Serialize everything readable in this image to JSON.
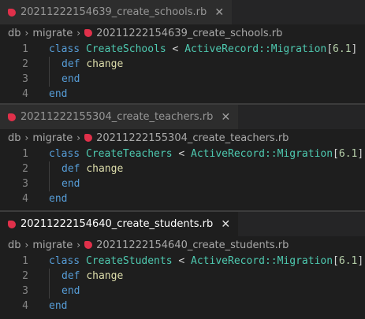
{
  "panes": [
    {
      "tab": {
        "filename": "20211222154639_create_schools.rb",
        "active": false,
        "close": "✕"
      },
      "breadcrumb": {
        "dir1": "db",
        "dir2": "migrate",
        "file": "20211222154639_create_schools.rb"
      },
      "code": {
        "line_numbers": [
          "1",
          "2",
          "3",
          "4"
        ],
        "class_kw": "class",
        "class_name": "CreateSchools",
        "lt": "<",
        "parent": "ActiveRecord::Migration",
        "bracket_open": "[",
        "version": "6.1",
        "bracket_close": "]",
        "def_kw": "def",
        "method": "change",
        "end_inner": "end",
        "end_outer": "end"
      }
    },
    {
      "tab": {
        "filename": "20211222155304_create_teachers.rb",
        "active": false,
        "close": "✕"
      },
      "breadcrumb": {
        "dir1": "db",
        "dir2": "migrate",
        "file": "20211222155304_create_teachers.rb"
      },
      "code": {
        "line_numbers": [
          "1",
          "2",
          "3",
          "4"
        ],
        "class_kw": "class",
        "class_name": "CreateTeachers",
        "lt": "<",
        "parent": "ActiveRecord::Migration",
        "bracket_open": "[",
        "version": "6.1",
        "bracket_close": "]",
        "def_kw": "def",
        "method": "change",
        "end_inner": "end",
        "end_outer": "end"
      }
    },
    {
      "tab": {
        "filename": "20211222154640_create_students.rb",
        "active": true,
        "close": "✕"
      },
      "breadcrumb": {
        "dir1": "db",
        "dir2": "migrate",
        "file": "20211222154640_create_students.rb"
      },
      "code": {
        "line_numbers": [
          "1",
          "2",
          "3",
          "4"
        ],
        "class_kw": "class",
        "class_name": "CreateStudents",
        "lt": "<",
        "parent": "ActiveRecord::Migration",
        "bracket_open": "[",
        "version": "6.1",
        "bracket_close": "]",
        "def_kw": "def",
        "method": "change",
        "end_inner": "end",
        "end_outer": "end"
      }
    }
  ],
  "breadcrumb_separator": "›",
  "icons": {
    "file": "ruby-file-icon",
    "close": "close-icon"
  },
  "colors": {
    "ruby_icon": "#e0304a",
    "keyword": "#569cd6",
    "control_keyword": "#c586c0",
    "class_name": "#4ec9b0",
    "method_name": "#dcdcaa",
    "number": "#b5cea8"
  }
}
